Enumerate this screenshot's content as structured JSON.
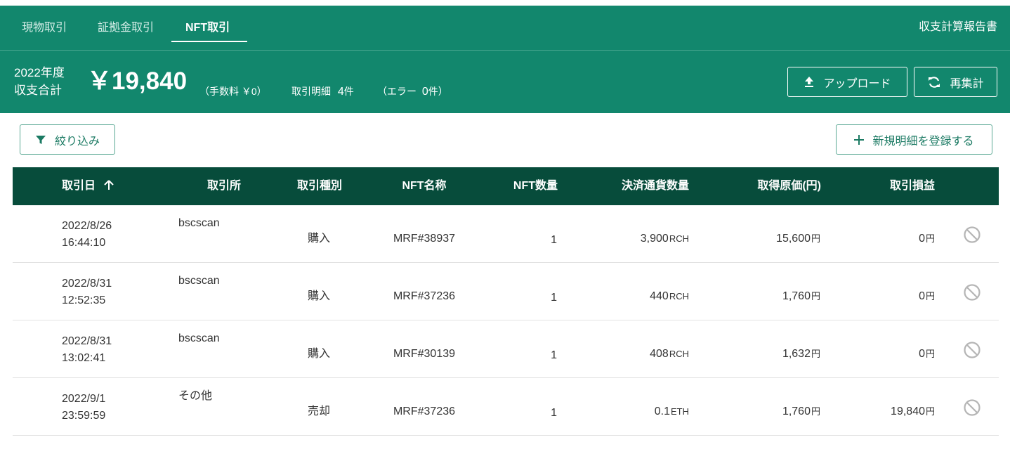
{
  "nav": {
    "tabs": [
      {
        "label": "現物取引",
        "active": false
      },
      {
        "label": "証拠金取引",
        "active": false
      },
      {
        "label": "NFT取引",
        "active": true
      }
    ],
    "report_link": "収支計算報告書"
  },
  "summary": {
    "year": "2022年度",
    "total_label": "収支合計",
    "total_amount": "￥19,840",
    "fee": "（手数料 ￥0）",
    "detail_label": "取引明細",
    "detail_count": "4",
    "detail_unit": "件",
    "error_open": "（エラー",
    "error_count": "0",
    "error_close": "件）",
    "upload_label": "アップロード",
    "recalc_label": "再集計"
  },
  "toolbar": {
    "filter_label": "絞り込み",
    "add_label": "新規明細を登録する"
  },
  "table": {
    "headers": {
      "date": "取引日",
      "exchange": "取引所",
      "type": "取引種別",
      "nft_name": "NFT名称",
      "nft_qty": "NFT数量",
      "pay_qty": "決済通貨数量",
      "cost": "取得原価(円)",
      "pnl": "取引損益"
    },
    "rows": [
      {
        "date": "2022/8/26",
        "time": "16:44:10",
        "exchange": "bscscan",
        "type": "購入",
        "nft_name": "MRF#38937",
        "nft_qty": "1",
        "pay_value": "3,900",
        "pay_unit": "RCH",
        "cost": "15,600",
        "cost_unit": "円",
        "pnl": "0",
        "pnl_unit": "円"
      },
      {
        "date": "2022/8/31",
        "time": "12:52:35",
        "exchange": "bscscan",
        "type": "購入",
        "nft_name": "MRF#37236",
        "nft_qty": "1",
        "pay_value": "440",
        "pay_unit": "RCH",
        "cost": "1,760",
        "cost_unit": "円",
        "pnl": "0",
        "pnl_unit": "円"
      },
      {
        "date": "2022/8/31",
        "time": "13:02:41",
        "exchange": "bscscan",
        "type": "購入",
        "nft_name": "MRF#30139",
        "nft_qty": "1",
        "pay_value": "408",
        "pay_unit": "RCH",
        "cost": "1,632",
        "cost_unit": "円",
        "pnl": "0",
        "pnl_unit": "円"
      },
      {
        "date": "2022/9/1",
        "time": "23:59:59",
        "exchange": "その他",
        "type": "売却",
        "nft_name": "MRF#37236",
        "nft_qty": "1",
        "pay_value": "0.1",
        "pay_unit": "ETH",
        "cost": "1,760",
        "cost_unit": "円",
        "pnl": "19,840",
        "pnl_unit": "円"
      }
    ]
  },
  "colors": {
    "brand": "#12876d",
    "table_header": "#074c3b",
    "button_text": "#1b7a63",
    "disabled_icon": "#b5b5b5"
  },
  "icons": {
    "upload": "upload-icon",
    "recalc": "refresh-icon",
    "filter": "filter-icon",
    "add": "plus-icon",
    "sort": "arrow-up-icon",
    "delete": "block-icon"
  }
}
